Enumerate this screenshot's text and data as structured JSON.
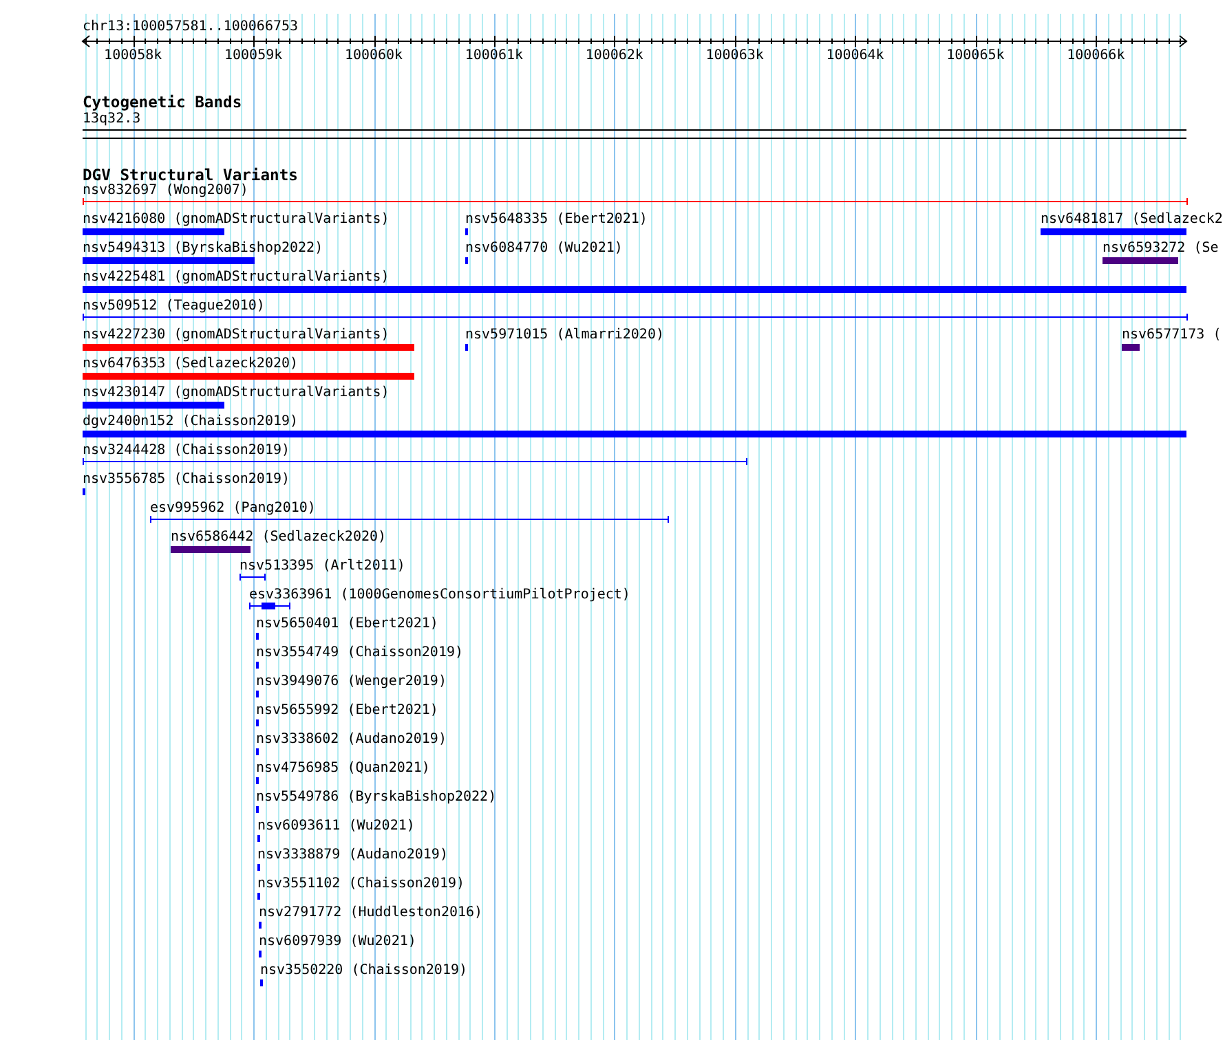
{
  "ruler": {
    "region": "chr13:100057581..100066753",
    "ticks": [
      "100058k",
      "100059k",
      "100060k",
      "100061k",
      "100062k",
      "100063k",
      "100064k",
      "100065k",
      "100066k"
    ]
  },
  "cytogenetic_bands": {
    "title": "Cytogenetic Bands",
    "band": "13q32.3"
  },
  "structural_variants": {
    "title": "DGV Structural Variants",
    "lanes": [
      {
        "features": [
          {
            "label": "nsv832697 (Wong2007)",
            "kind": "span",
            "color": "#ff0000"
          }
        ]
      },
      {
        "features": [
          {
            "label": "nsv4216080 (gnomADStructuralVariants)",
            "kind": "block",
            "color": "#0000ff"
          },
          {
            "label": "nsv5648335 (Ebert2021)",
            "kind": "block",
            "color": "#0000ff"
          },
          {
            "label": "nsv6481817 (Sedlazeck2",
            "kind": "block",
            "color": "#0000ff"
          }
        ]
      },
      {
        "features": [
          {
            "label": "nsv5494313 (ByrskaBishop2022)",
            "kind": "block",
            "color": "#0000ff"
          },
          {
            "label": "nsv6084770 (Wu2021)",
            "kind": "block",
            "color": "#0000ff"
          },
          {
            "label": "nsv6593272 (Se",
            "kind": "block",
            "color": "#4b0082"
          }
        ]
      },
      {
        "features": [
          {
            "label": "nsv4225481 (gnomADStructuralVariants)",
            "kind": "block",
            "color": "#0000ff"
          }
        ]
      },
      {
        "features": [
          {
            "label": "nsv509512 (Teague2010)",
            "kind": "span",
            "color": "#0000ff"
          }
        ]
      },
      {
        "features": [
          {
            "label": "nsv4227230 (gnomADStructuralVariants)",
            "kind": "block",
            "color": "#ff0000"
          },
          {
            "label": "nsv5971015 (Almarri2020)",
            "kind": "block",
            "color": "#0000ff"
          },
          {
            "label": "nsv6577173 (",
            "kind": "block",
            "color": "#4b0082"
          }
        ]
      },
      {
        "features": [
          {
            "label": "nsv6476353 (Sedlazeck2020)",
            "kind": "block",
            "color": "#ff0000"
          }
        ]
      },
      {
        "features": [
          {
            "label": "nsv4230147 (gnomADStructuralVariants)",
            "kind": "block",
            "color": "#0000ff"
          }
        ]
      },
      {
        "features": [
          {
            "label": "dgv2400n152 (Chaisson2019)",
            "kind": "block",
            "color": "#0000ff"
          }
        ]
      },
      {
        "features": [
          {
            "label": "nsv3244428 (Chaisson2019)",
            "kind": "span",
            "color": "#0000ff"
          }
        ]
      },
      {
        "features": [
          {
            "label": "nsv3556785 (Chaisson2019)",
            "kind": "block",
            "color": "#0000ff"
          }
        ]
      },
      {
        "features": [
          {
            "label": "esv995962 (Pang2010)",
            "kind": "span",
            "color": "#0000ff"
          }
        ]
      },
      {
        "features": [
          {
            "label": "nsv6586442 (Sedlazeck2020)",
            "kind": "block",
            "color": "#4b0082"
          }
        ]
      },
      {
        "features": [
          {
            "label": "nsv513395 (Arlt2011)",
            "kind": "span",
            "color": "#0000ff"
          }
        ]
      },
      {
        "features": [
          {
            "label": "esv3363961 (1000GenomesConsortiumPilotProject)",
            "kind": "span_block",
            "color": "#0000ff"
          }
        ]
      },
      {
        "features": [
          {
            "label": "nsv5650401 (Ebert2021)",
            "kind": "block",
            "color": "#0000ff"
          }
        ]
      },
      {
        "features": [
          {
            "label": "nsv3554749 (Chaisson2019)",
            "kind": "block",
            "color": "#0000ff"
          }
        ]
      },
      {
        "features": [
          {
            "label": "nsv3949076 (Wenger2019)",
            "kind": "block",
            "color": "#0000ff"
          }
        ]
      },
      {
        "features": [
          {
            "label": "nsv5655992 (Ebert2021)",
            "kind": "block",
            "color": "#0000ff"
          }
        ]
      },
      {
        "features": [
          {
            "label": "nsv3338602 (Audano2019)",
            "kind": "block",
            "color": "#0000ff"
          }
        ]
      },
      {
        "features": [
          {
            "label": "nsv4756985 (Quan2021)",
            "kind": "block",
            "color": "#0000ff"
          }
        ]
      },
      {
        "features": [
          {
            "label": "nsv5549786 (ByrskaBishop2022)",
            "kind": "block",
            "color": "#0000ff"
          }
        ]
      },
      {
        "features": [
          {
            "label": "nsv6093611 (Wu2021)",
            "kind": "block",
            "color": "#0000ff"
          }
        ]
      },
      {
        "features": [
          {
            "label": "nsv3338879 (Audano2019)",
            "kind": "block",
            "color": "#0000ff"
          }
        ]
      },
      {
        "features": [
          {
            "label": "nsv3551102 (Chaisson2019)",
            "kind": "block",
            "color": "#0000ff"
          }
        ]
      },
      {
        "features": [
          {
            "label": "nsv2791772 (Huddleston2016)",
            "kind": "block",
            "color": "#0000ff"
          }
        ]
      },
      {
        "features": [
          {
            "label": "nsv6097939 (Wu2021)",
            "kind": "block",
            "color": "#0000ff"
          }
        ]
      },
      {
        "features": [
          {
            "label": "nsv3550220 (Chaisson2019)",
            "kind": "block",
            "color": "#0000ff"
          }
        ]
      }
    ]
  }
}
